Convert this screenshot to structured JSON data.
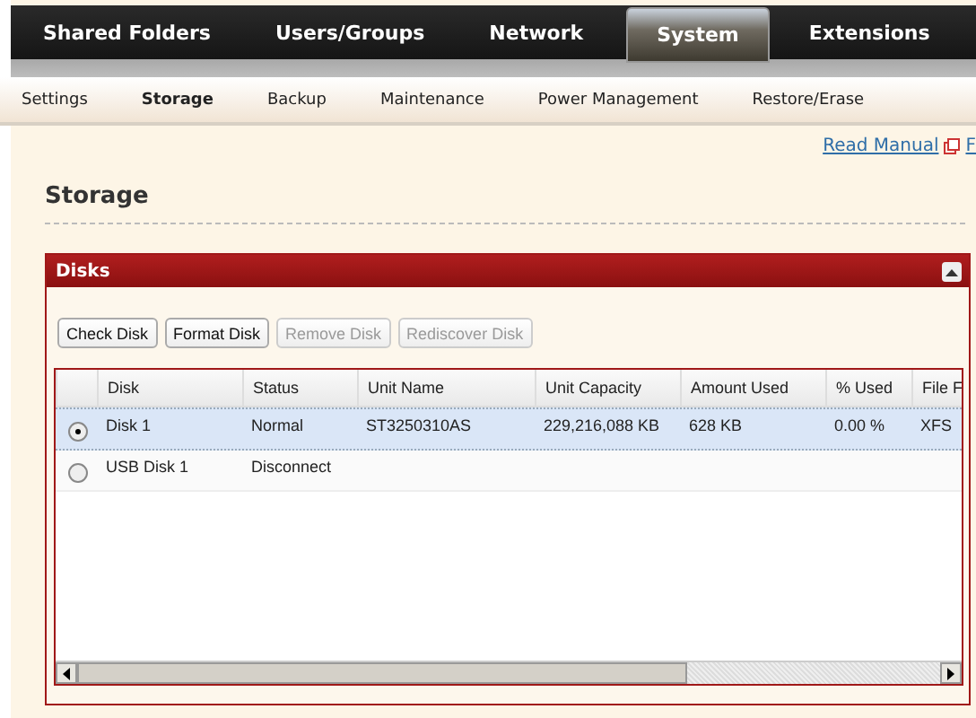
{
  "main_nav": [
    {
      "label": "Shared Folders",
      "selected": false
    },
    {
      "label": "Users/Groups",
      "selected": false
    },
    {
      "label": "Network",
      "selected": false
    },
    {
      "label": "System",
      "selected": true
    },
    {
      "label": "Extensions",
      "selected": false
    }
  ],
  "sub_nav": [
    {
      "label": "Settings",
      "selected": false
    },
    {
      "label": "Storage",
      "selected": true
    },
    {
      "label": "Backup",
      "selected": false
    },
    {
      "label": "Maintenance",
      "selected": false
    },
    {
      "label": "Power Management",
      "selected": false
    },
    {
      "label": "Restore/Erase",
      "selected": false
    }
  ],
  "help_links": [
    "Read Manual",
    "F"
  ],
  "page_title": "Storage",
  "panel": {
    "title": "Disks",
    "expanded": true,
    "buttons": [
      {
        "label": "Check Disk",
        "disabled": false
      },
      {
        "label": "Format Disk",
        "disabled": false
      },
      {
        "label": "Remove Disk",
        "disabled": true
      },
      {
        "label": "Rediscover Disk",
        "disabled": true
      }
    ],
    "table": {
      "columns": [
        "Disk",
        "Status",
        "Unit Name",
        "Unit Capacity",
        "Amount Used",
        "% Used",
        "File F"
      ],
      "rows": [
        {
          "selected": true,
          "cells": [
            "Disk 1",
            "Normal",
            "ST3250310AS",
            "229,216,088 KB",
            "628 KB",
            "0.00 %",
            "XFS"
          ]
        },
        {
          "selected": false,
          "cells": [
            "USB Disk 1",
            "Disconnect",
            "",
            "",
            "",
            "",
            ""
          ]
        }
      ]
    }
  }
}
